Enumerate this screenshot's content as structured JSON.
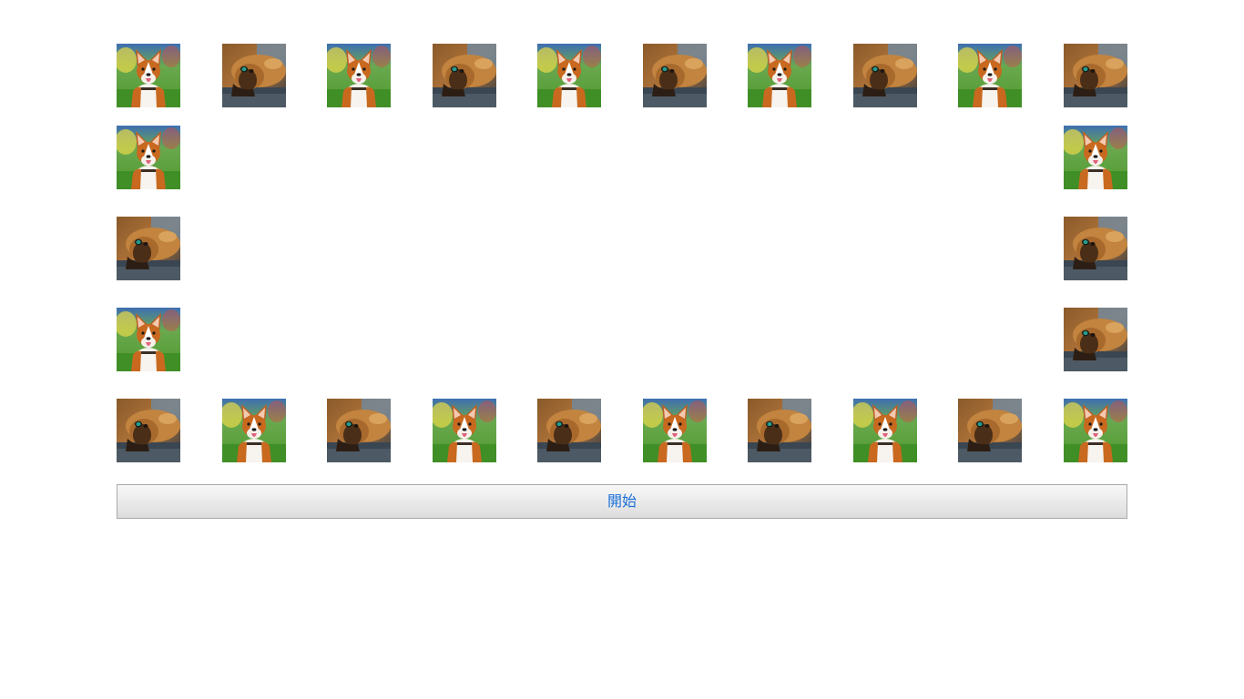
{
  "grid": {
    "columns": 10,
    "rows": 5,
    "tiles": [
      "corgi",
      "brown-dog",
      "corgi",
      "brown-dog",
      "corgi",
      "brown-dog",
      "corgi",
      "brown-dog",
      "corgi",
      "brown-dog",
      "corgi",
      "brown-dog",
      "corgi",
      "brown-dog",
      "corgi",
      "brown-dog",
      "corgi",
      "brown-dog",
      "corgi",
      "brown-dog",
      "corgi",
      "corgi",
      "brown-dog",
      "brown-dog",
      "corgi",
      "brown-dog"
    ]
  },
  "start_button": {
    "label": "開始"
  },
  "colors": {
    "button_text": "#1a6fd8",
    "button_border": "#a9a9a9"
  }
}
